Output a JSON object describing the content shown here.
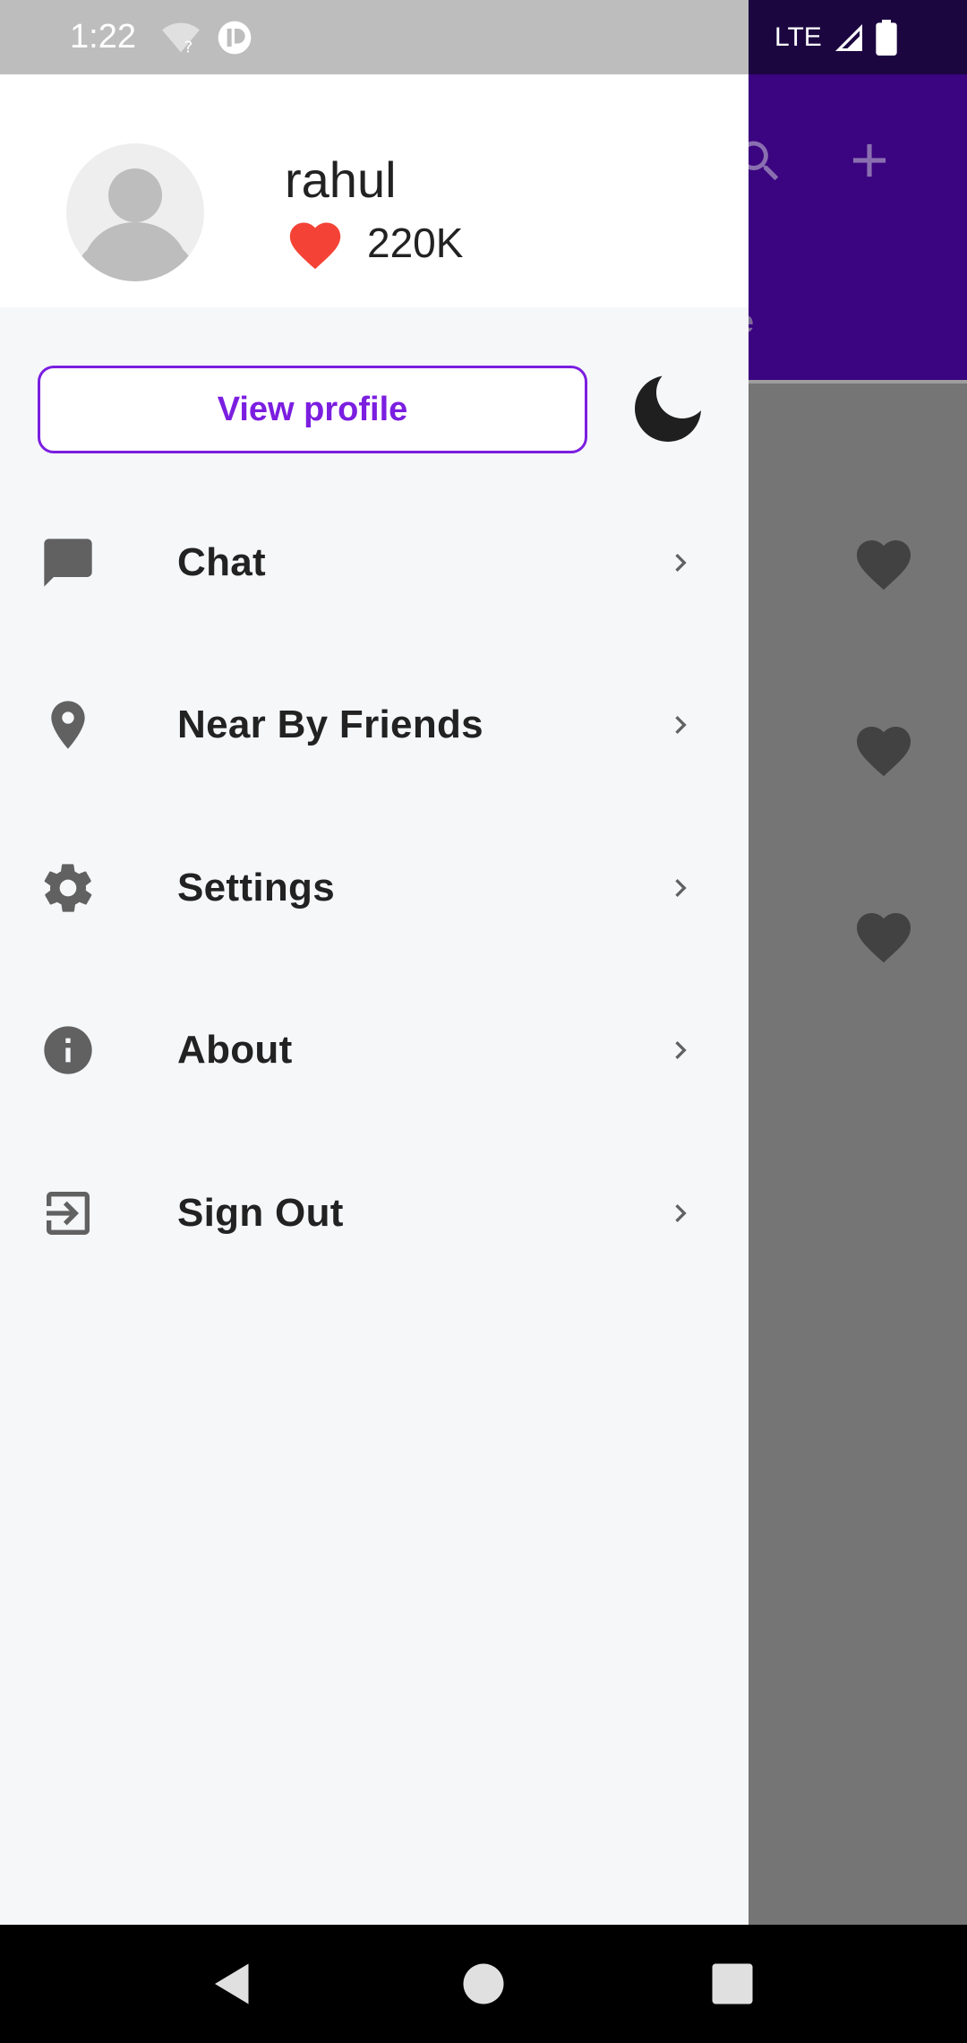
{
  "status_bar": {
    "time": "1:22",
    "network": "LTE"
  },
  "background": {
    "tab_partial": "ne"
  },
  "drawer": {
    "user": {
      "name": "rahul",
      "likes": "220K"
    },
    "view_profile_label": "View profile",
    "menu": [
      {
        "label": "Chat",
        "icon": "chat-icon"
      },
      {
        "label": "Near By Friends",
        "icon": "location-pin-icon"
      },
      {
        "label": "Settings",
        "icon": "gear-icon"
      },
      {
        "label": "About",
        "icon": "info-icon"
      },
      {
        "label": "Sign Out",
        "icon": "sign-out-icon"
      }
    ]
  },
  "colors": {
    "accent": "#7b1ee0",
    "app_bar": "#3b0480",
    "heart": "#f44336"
  }
}
